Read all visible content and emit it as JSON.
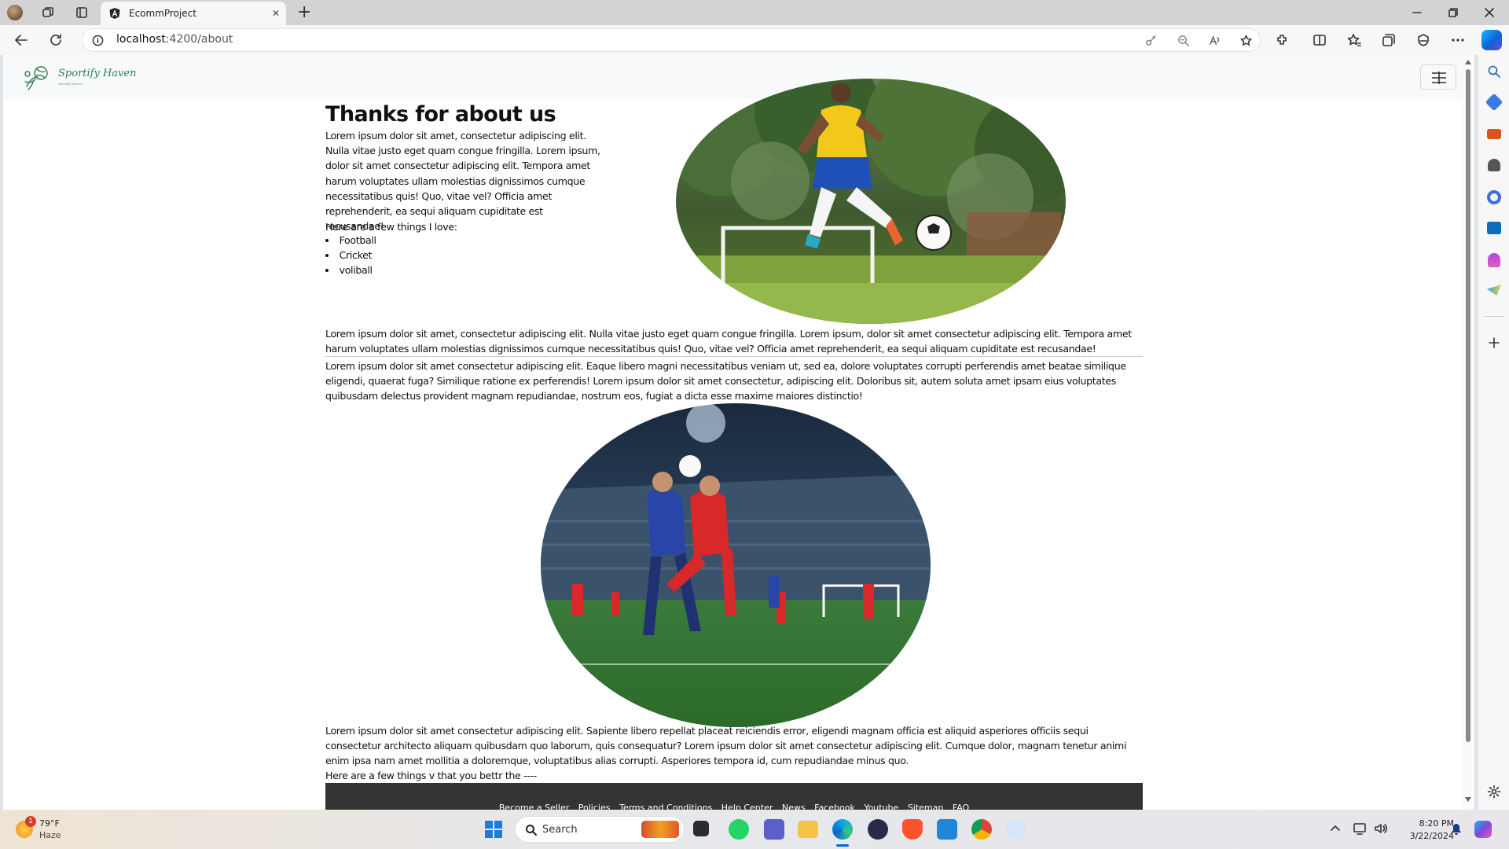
{
  "browser": {
    "tab_title": "EcommProject",
    "url_host": "localhost",
    "url_path": ":4200/about",
    "close_tab": "✕",
    "new_tab": "+"
  },
  "app": {
    "logo_text": "Sportify Haven",
    "logo_tagline": "Sportify Haven"
  },
  "about": {
    "title": "Thanks for about us",
    "intro": "Lorem ipsum dolor sit amet, consectetur adipiscing elit. Nulla vitae justo eget quam congue fringilla. Lorem ipsum, dolor sit amet consectetur adipiscing elit. Tempora amet harum voluptates ullam molestias dignissimos cumque necessitatibus quis! Quo, vitae vel? Officia amet reprehenderit, ea sequi aliquam cupiditate est recusandae!",
    "likes_heading": "Here are a few things I love:",
    "likes": [
      "Football",
      "Cricket",
      "voliball"
    ],
    "paragraph2": "Lorem ipsum dolor sit amet, consectetur adipiscing elit. Nulla vitae justo eget quam congue fringilla. Lorem ipsum, dolor sit amet consectetur adipiscing elit. Tempora amet harum voluptates ullam molestias dignissimos cumque necessitatibus quis! Quo, vitae vel? Officia amet reprehenderit, ea sequi aliquam cupiditate est recusandae!",
    "paragraph3": "Lorem ipsum dolor sit amet consectetur adipiscing elit. Eaque libero magni necessitatibus veniam ut, sed ea, dolore voluptates corrupti perferendis amet beatae similique eligendi, quaerat fuga? Similique ratione ex perferendis! Lorem ipsum dolor sit amet consectetur, adipiscing elit. Doloribus sit, autem soluta amet ipsam eius voluptates quibusdam delectus provident magnam repudiandae, nostrum eos, fugiat a dicta esse maxime maiores distinctio!",
    "paragraph4": "Lorem ipsum dolor sit amet consectetur adipiscing elit. Sapiente libero repellat placeat reiciendis error, eligendi magnam officia est aliquid asperiores officiis sequi consectetur architecto aliquam quibusdam quo laborum, quis consequatur? Lorem ipsum dolor sit amet consectetur adipiscing elit. Cumque dolor, magnam tenetur animi enim ipsa nam amet mollitia a doloremque, voluptatibus alias corrupti. Asperiores tempora id, cum repudiandae minus quo.",
    "few_things": "Here are a few things v that you bettr the ----"
  },
  "footer": {
    "links": [
      "Become a Seller",
      "Policies",
      "Terms and Conditions",
      "Help Center",
      "News",
      "Facebook",
      "Youtube",
      "Sitemap",
      "FAQ"
    ]
  },
  "taskbar": {
    "weather_temp": "79°F",
    "weather_desc": "Haze",
    "weather_badge": "1",
    "search_placeholder": "Search",
    "time": "8:20 PM",
    "date": "3/22/2024"
  },
  "colors": {
    "footer_bg": "#343434",
    "edge_accent": "#0a64d6"
  }
}
